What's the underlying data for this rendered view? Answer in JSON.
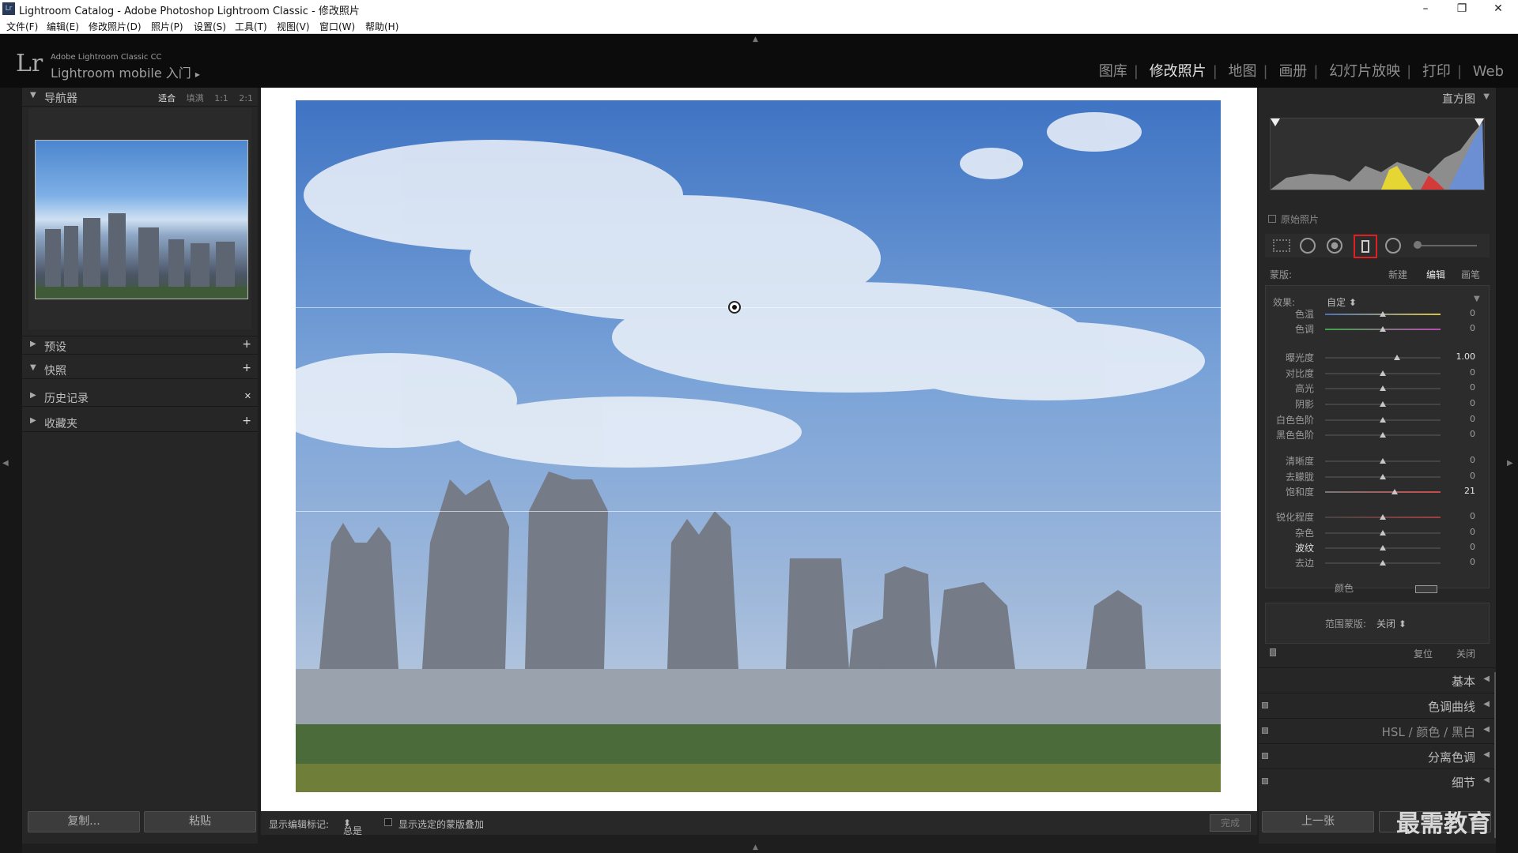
{
  "window": {
    "title": "Lightroom Catalog - Adobe Photoshop Lightroom Classic - 修改照片",
    "logo": "Lr",
    "controls": [
      "–",
      "❐",
      "✕"
    ]
  },
  "menu": [
    "文件(F)",
    "编辑(E)",
    "修改照片(D)",
    "照片(P)",
    "设置(S)",
    "工具(T)",
    "视图(V)",
    "窗口(W)",
    "帮助(H)"
  ],
  "identity": {
    "logo": "Lr",
    "product": "Adobe Lightroom Classic CC",
    "mobile": "Lightroom mobile 入门",
    "arrow": "▸"
  },
  "modules": [
    "图库",
    "修改照片",
    "地图",
    "画册",
    "幻灯片放映",
    "打印",
    "Web"
  ],
  "active_module": "修改照片",
  "left_panel": {
    "navigator": {
      "label": "导航器",
      "zoom": [
        "适合",
        "填满",
        "1:1",
        "2:1"
      ],
      "zoom_active": "适合"
    },
    "sections": [
      {
        "label": "预设",
        "action": "+"
      },
      {
        "label": "快照",
        "action": "+"
      },
      {
        "label": "历史记录",
        "action": "✕"
      },
      {
        "label": "收藏夹",
        "action": "+"
      }
    ],
    "copy_button": "复制...",
    "paste_button": "粘贴"
  },
  "toolbar": {
    "show_pins_label": "显示编辑标记:",
    "show_pins_value": "总是",
    "overlay_label": "显示选定的蒙版叠加",
    "done_button": "完成"
  },
  "right_panel": {
    "histogram_label": "直方图",
    "original_photo": "原始照片",
    "mask_label": "蒙版:",
    "mask_new": "新建",
    "mask_edit": "编辑",
    "mask_brush": "画笔",
    "effect_label": "效果:",
    "effect_value": "自定",
    "adjustments": [
      {
        "label": "色温",
        "value": "0",
        "pos": 0.5
      },
      {
        "label": "色调",
        "value": "0",
        "pos": 0.5
      },
      {
        "label": "曝光度",
        "value": "1.00",
        "pos": 0.62
      },
      {
        "label": "对比度",
        "value": "0",
        "pos": 0.5
      },
      {
        "label": "高光",
        "value": "0",
        "pos": 0.5
      },
      {
        "label": "阴影",
        "value": "0",
        "pos": 0.5
      },
      {
        "label": "白色色阶",
        "value": "0",
        "pos": 0.5
      },
      {
        "label": "黑色色阶",
        "value": "0",
        "pos": 0.5
      },
      {
        "label": "清晰度",
        "value": "0",
        "pos": 0.5
      },
      {
        "label": "去朦胧",
        "value": "0",
        "pos": 0.5
      },
      {
        "label": "饱和度",
        "value": "21",
        "pos": 0.6
      },
      {
        "label": "锐化程度",
        "value": "0",
        "pos": 0.5
      },
      {
        "label": "杂色",
        "value": "0",
        "pos": 0.5
      },
      {
        "label": "波纹",
        "value": "0",
        "pos": 0.5
      },
      {
        "label": "去边",
        "value": "0",
        "pos": 0.5
      }
    ],
    "color_label": "颜色",
    "range_mask_label": "范围蒙版:",
    "range_mask_value": "关闭",
    "reset_button": "复位",
    "close_button": "关闭",
    "sections": [
      "基本",
      "色调曲线",
      "HSL / 颜色 / 黑白",
      "分离色调",
      "细节"
    ],
    "prev_button": "上一张",
    "colors": {
      "red_highlight": "#e02020"
    }
  },
  "watermark": "最需教育"
}
